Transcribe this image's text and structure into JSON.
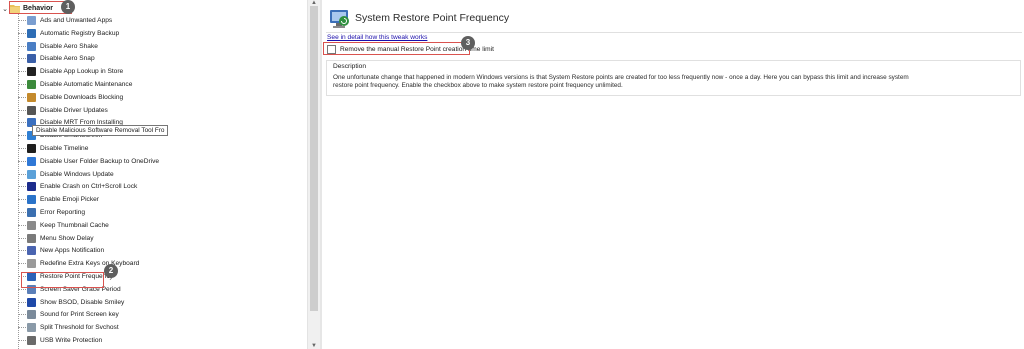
{
  "tree": {
    "root_label": "Behavior",
    "tooltip": "Disable Malicious Software Removal Tool Fro",
    "items": [
      {
        "label": "Ads and Unwanted Apps",
        "icon": "ads-icon",
        "color": "#7a9ed0"
      },
      {
        "label": "Automatic Registry Backup",
        "icon": "registry-icon",
        "color": "#2d6db5"
      },
      {
        "label": "Disable Aero Shake",
        "icon": "window-icon",
        "color": "#4a7ec4"
      },
      {
        "label": "Disable Aero Snap",
        "icon": "grid-icon",
        "color": "#3a5fa8"
      },
      {
        "label": "Disable App Lookup in Store",
        "icon": "no-entry-icon",
        "color": "#222222"
      },
      {
        "label": "Disable Automatic Maintenance",
        "icon": "maintenance-icon",
        "color": "#3c8a3c"
      },
      {
        "label": "Disable Downloads Blocking",
        "icon": "download-icon",
        "color": "#c48a2c"
      },
      {
        "label": "Disable Driver Updates",
        "icon": "driver-icon",
        "color": "#555555"
      },
      {
        "label": "Disable MRT From Installing",
        "icon": "mrt-icon",
        "color": "#3a6fbf"
      },
      {
        "label": "Disable SmartScreen",
        "icon": "shield-icon",
        "color": "#2f7fd3"
      },
      {
        "label": "Disable Timeline",
        "icon": "timeline-icon",
        "color": "#1e1e1e"
      },
      {
        "label": "Disable User Folder Backup to OneDrive",
        "icon": "onedrive-icon",
        "color": "#2f78d6"
      },
      {
        "label": "Disable Windows Update",
        "icon": "update-icon",
        "color": "#5aa0d8"
      },
      {
        "label": "Enable Crash on Ctrl+Scroll Lock",
        "icon": "crash-icon",
        "color": "#1c2c8c"
      },
      {
        "label": "Enable Emoji Picker",
        "icon": "emoji-icon",
        "color": "#2a73c9"
      },
      {
        "label": "Error Reporting",
        "icon": "error-icon",
        "color": "#3b6fb0"
      },
      {
        "label": "Keep Thumbnail Cache",
        "icon": "thumbnail-icon",
        "color": "#8a8a8a"
      },
      {
        "label": "Menu Show Delay",
        "icon": "menu-icon",
        "color": "#7a7a7a"
      },
      {
        "label": "New Apps Notification",
        "icon": "notification-icon",
        "color": "#4a64b0"
      },
      {
        "label": "Redefine Extra Keys on Keyboard",
        "icon": "keyboard-icon",
        "color": "#9a9a9a"
      },
      {
        "label": "Restore Point Frequency",
        "icon": "restore-icon",
        "color": "#2c62b8"
      },
      {
        "label": "Screen Saver Grace Period",
        "icon": "screensaver-icon",
        "color": "#5b7fb8"
      },
      {
        "label": "Show BSOD, Disable Smiley",
        "icon": "bsod-icon",
        "color": "#1f49a8"
      },
      {
        "label": "Sound for Print Screen key",
        "icon": "sound-icon",
        "color": "#7a8a9a"
      },
      {
        "label": "Split Threshold for Svchost",
        "icon": "split-icon",
        "color": "#8a9aa8"
      },
      {
        "label": "USB Write Protection",
        "icon": "usb-icon",
        "color": "#6a6a6a"
      }
    ]
  },
  "detail": {
    "title": "System Restore Point Frequency",
    "link": "See in detail how this tweak works",
    "checkbox_label": "Remove the manual Restore Point creation time limit",
    "checkbox_checked": false,
    "description_title": "Description",
    "description": "One unfortunate change that happened in modern Windows versions is that System Restore points are created for too less frequently now - once a day. Here you can bypass this limit and increase system restore point frequency. Enable the checkbox above to make system restore point frequency unlimited."
  },
  "badges": [
    "1",
    "2",
    "3"
  ],
  "accent": {
    "highlight_box": "#d9534f",
    "badge": "#5f5f5f",
    "link": "#1a0dab"
  }
}
